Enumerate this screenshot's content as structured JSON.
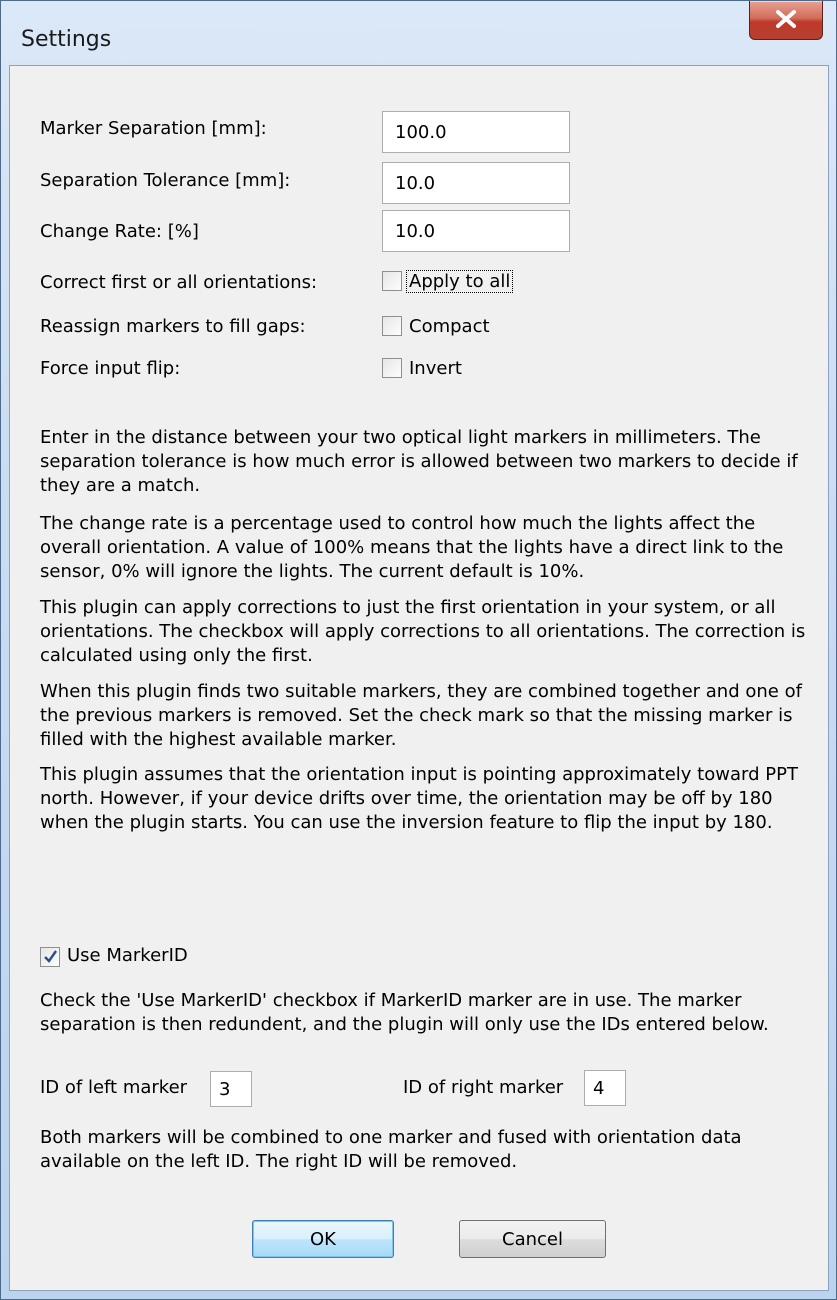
{
  "window": {
    "title": "Settings"
  },
  "fields": {
    "marker_separation": {
      "label": "Marker Separation [mm]:",
      "value": "100.0"
    },
    "separation_tolerance": {
      "label": "Separation Tolerance [mm]:",
      "value": "10.0"
    },
    "change_rate": {
      "label": "Change Rate: [%]",
      "value": "10.0"
    }
  },
  "options": {
    "apply_to_all": {
      "label": "Correct first or all orientations:",
      "checkbox_label": "Apply to all",
      "checked": false
    },
    "compact": {
      "label": "Reassign markers to fill gaps:",
      "checkbox_label": "Compact",
      "checked": false
    },
    "invert": {
      "label": "Force input flip:",
      "checkbox_label": "Invert",
      "checked": false
    }
  },
  "help": {
    "p1": "Enter in the distance between your two optical light markers in millimeters. The separation tolerance is how much error is allowed between two markers to decide if they are a match.",
    "p2": "The change rate is a percentage used to control how much the lights affect the overall orientation. A value of 100% means that the lights have a direct link to the sensor, 0% will ignore the lights. The current default is 10%.",
    "p3": "This plugin can apply corrections to just the first orientation in your system, or all orientations. The checkbox will apply corrections to all orientations. The correction is calculated using only the first.",
    "p4": "When this plugin finds two suitable markers, they are combined together and one of the previous markers is removed. Set the check mark so that the missing marker is filled with the highest available marker.",
    "p5": "This plugin assumes that the orientation input is pointing approximately toward PPT north. However, if your device drifts over time, the orientation may be off by 180 when the plugin starts. You can use the inversion feature to flip the input by 180."
  },
  "marker_id": {
    "checkbox_label": "Use MarkerID",
    "checked": true,
    "description": "Check the 'Use MarkerID' checkbox if MarkerID marker are in use. The marker separation is then redundent, and the plugin will only use the IDs entered below.",
    "left_label": "ID of left marker",
    "left_value": "3",
    "right_label": "ID of right marker",
    "right_value": "4",
    "note": "Both markers will be combined to one marker and fused with orientation data available on the left ID. The right ID will be removed."
  },
  "buttons": {
    "ok": "OK",
    "cancel": "Cancel"
  }
}
